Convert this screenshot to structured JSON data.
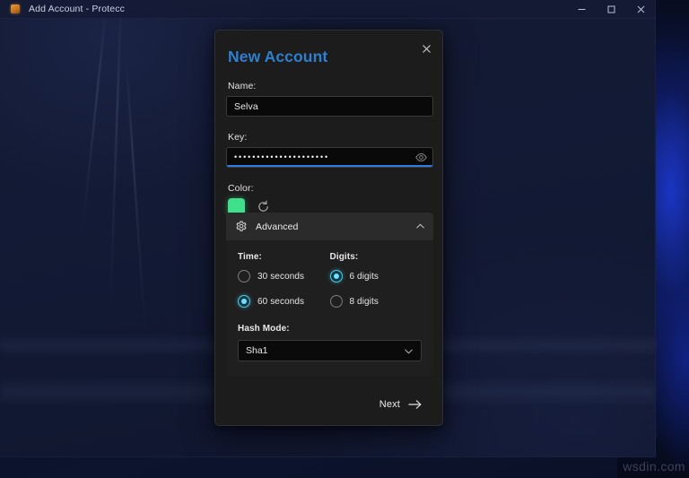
{
  "window": {
    "title": "Add Account - Protecc",
    "icon": "app-icon",
    "controls": {
      "minimize": "minimize-icon",
      "maximize": "maximize-icon",
      "close": "close-icon"
    }
  },
  "dialog": {
    "title": "New Account",
    "close_icon": "close-icon",
    "name": {
      "label": "Name:",
      "value": "Selva",
      "placeholder": ""
    },
    "key": {
      "label": "Key:",
      "value": "•••••••••••••••••••••",
      "placeholder": "",
      "reveal_icon": "eye-icon"
    },
    "color": {
      "label": "Color:",
      "swatch_hex": "#3FE08C",
      "randomize_icon": "refresh-icon"
    },
    "advanced": {
      "label": "Advanced",
      "gear_icon": "gear-icon",
      "chevron_icon": "chevron-up-icon",
      "expanded": true,
      "time": {
        "label": "Time:",
        "options": [
          {
            "label": "30 seconds",
            "selected": false
          },
          {
            "label": "60 seconds",
            "selected": true
          }
        ]
      },
      "digits": {
        "label": "Digits:",
        "options": [
          {
            "label": "6 digits",
            "selected": true
          },
          {
            "label": "8 digits",
            "selected": false
          }
        ]
      },
      "hash_mode": {
        "label": "Hash Mode:",
        "value": "Sha1",
        "chevron_icon": "chevron-down-icon"
      }
    },
    "footer": {
      "next_label": "Next",
      "next_icon": "arrow-right-icon"
    },
    "accent_hex": "#2F7FD0",
    "focus_hex": "#2B7DE0",
    "radio_hex": "#6FE0FA"
  },
  "watermark": {
    "text": "wsdin.com"
  }
}
